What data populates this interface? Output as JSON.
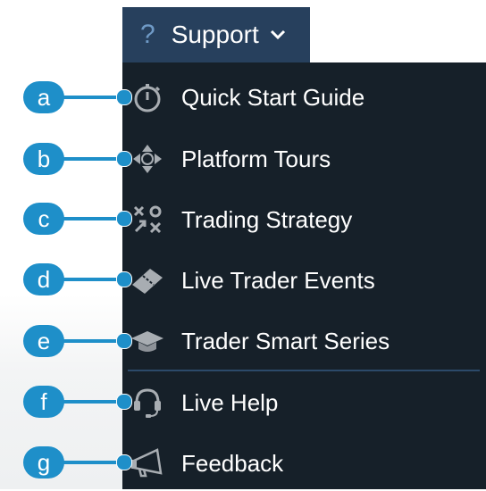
{
  "support": {
    "icon": "question-icon",
    "glyph": "?",
    "label": "Support",
    "chevron": "chevron-down-icon"
  },
  "menu": {
    "items": [
      {
        "badge": "a",
        "icon": "stopwatch-icon",
        "label": "Quick Start Guide"
      },
      {
        "badge": "b",
        "icon": "move-arrows-icon",
        "label": "Platform Tours"
      },
      {
        "badge": "c",
        "icon": "strategy-xo-icon",
        "label": "Trading Strategy"
      },
      {
        "badge": "d",
        "icon": "ticket-icon",
        "label": "Live Trader Events"
      },
      {
        "badge": "e",
        "icon": "graduation-cap-icon",
        "label": "Trader Smart Series"
      },
      {
        "badge": "f",
        "icon": "headset-icon",
        "label": "Live Help"
      },
      {
        "badge": "g",
        "icon": "megaphone-icon",
        "label": "Feedback"
      }
    ]
  },
  "colors": {
    "support_bg": "#27405d",
    "menu_bg": "#162029",
    "callout": "#1e8fc9",
    "divider": "#2c4a6a",
    "icon_gray": "#a8adb2"
  }
}
